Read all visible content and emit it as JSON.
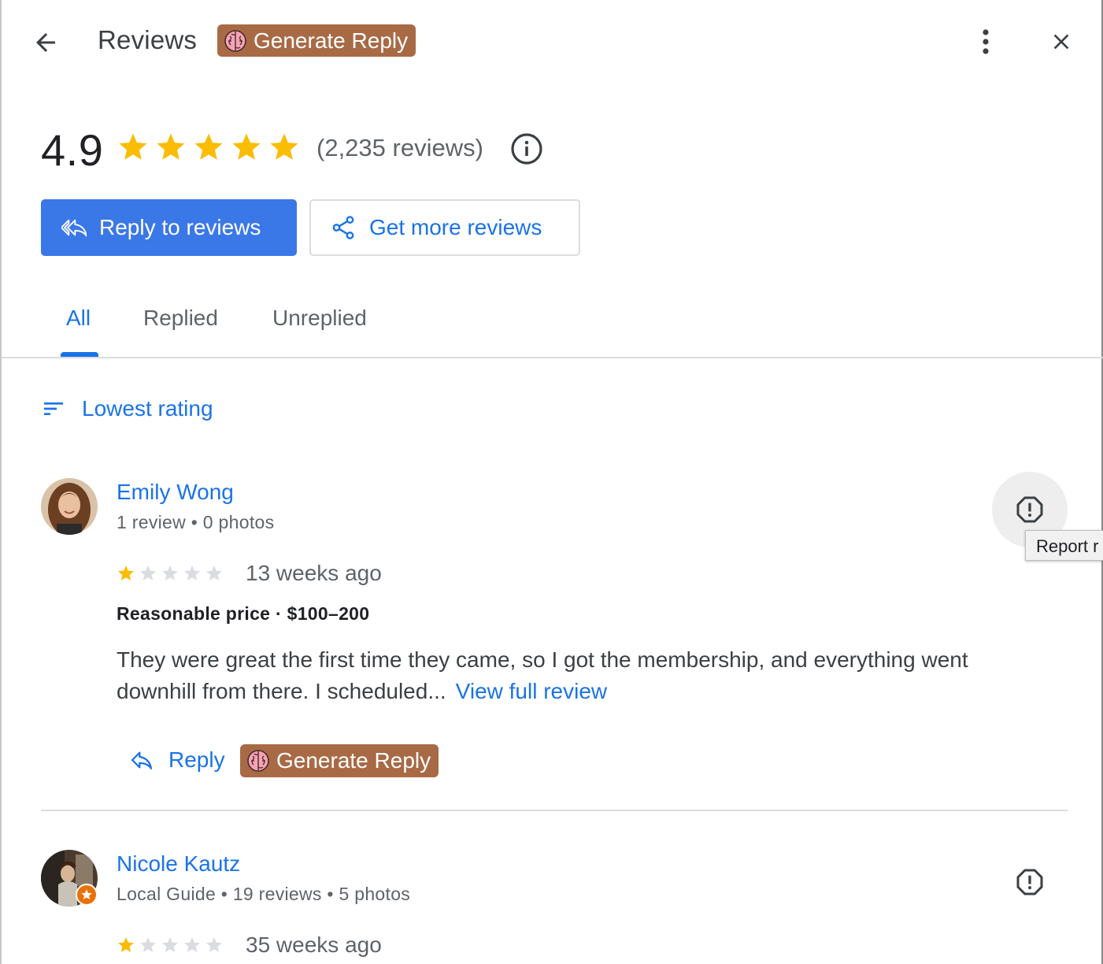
{
  "header": {
    "title": "Reviews",
    "generate_reply_label": "Generate Reply",
    "icons": [
      "arrow-back-icon",
      "brain-icon",
      "more-vert-icon",
      "close-icon"
    ]
  },
  "summary": {
    "rating": "4.9",
    "stars": 5,
    "count_text": "(2,235 reviews)"
  },
  "actions": {
    "reply_to_reviews": "Reply to reviews",
    "get_more_reviews": "Get more reviews"
  },
  "tabs": [
    {
      "label": "All",
      "active": true
    },
    {
      "label": "Replied",
      "active": false
    },
    {
      "label": "Unreplied",
      "active": false
    }
  ],
  "sort": {
    "label": "Lowest rating"
  },
  "reviews": [
    {
      "name": "Emily Wong",
      "meta": "1 review • 0 photos",
      "rating": 1,
      "date": "13 weeks ago",
      "attributes": "Reasonable price · $100–200",
      "text": "They were great the first time they came, so I got the membership, and everything went downhill from there. I scheduled...",
      "view_full_label": "View full review",
      "reply_label": "Reply",
      "generate_reply_label": "Generate Reply",
      "report_tooltip": "Report r"
    },
    {
      "name": "Nicole Kautz",
      "meta": "Local Guide • 19 reviews • 5 photos",
      "rating": 1,
      "date": "35 weeks ago"
    }
  ],
  "colors": {
    "accent_blue": "#1a73e8",
    "primary_button": "#3b78e7",
    "star_gold": "#fbbc04",
    "star_empty": "#dadce0",
    "generate_reply_bg": "#a86a45",
    "local_guide_badge": "#e8710a"
  }
}
